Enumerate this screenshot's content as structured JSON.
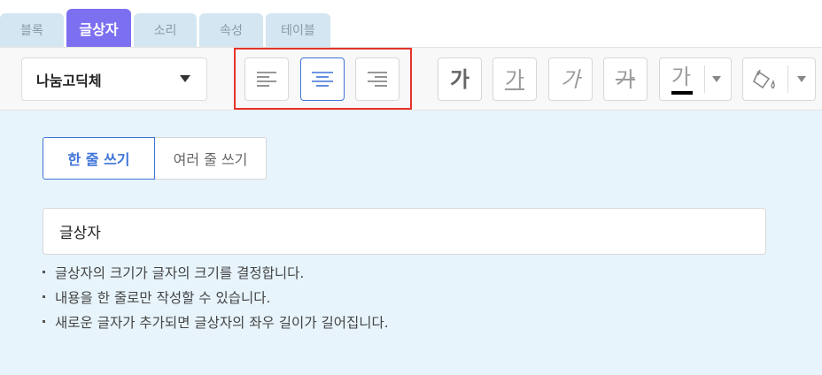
{
  "tabs": [
    {
      "label": "블록",
      "active": false
    },
    {
      "label": "글상자",
      "active": true
    },
    {
      "label": "소리",
      "active": false
    },
    {
      "label": "속성",
      "active": false
    },
    {
      "label": "테이블",
      "active": false
    }
  ],
  "toolbar": {
    "font_select": {
      "value": "나눔고딕체"
    },
    "align_buttons": [
      {
        "name": "align-left",
        "active": false
      },
      {
        "name": "align-center",
        "active": true
      },
      {
        "name": "align-right",
        "active": false
      }
    ],
    "style_buttons": {
      "bold": "가",
      "underline": "가",
      "italic": "가",
      "strikethrough": "가",
      "text_color": "가"
    },
    "text_color_swatch": "#000000",
    "highlight_color": "#e5332a"
  },
  "mode_tabs": [
    {
      "label": "한 줄 쓰기",
      "active": true
    },
    {
      "label": "여러 줄 쓰기",
      "active": false
    }
  ],
  "textbox": {
    "value": "글상자"
  },
  "notes": [
    "글상자의 크기가 글자의 크기를 결정합니다.",
    "내용을 한 줄로만 작성할 수 있습니다.",
    "새로운 글자가 추가되면 글상자의 좌우 길이가 길어집니다."
  ],
  "colors": {
    "accent": "#7c6ff0",
    "tab_inactive": "#d3e6f1",
    "primary_blue": "#3e73d8",
    "content_bg": "#e7f4fc"
  }
}
